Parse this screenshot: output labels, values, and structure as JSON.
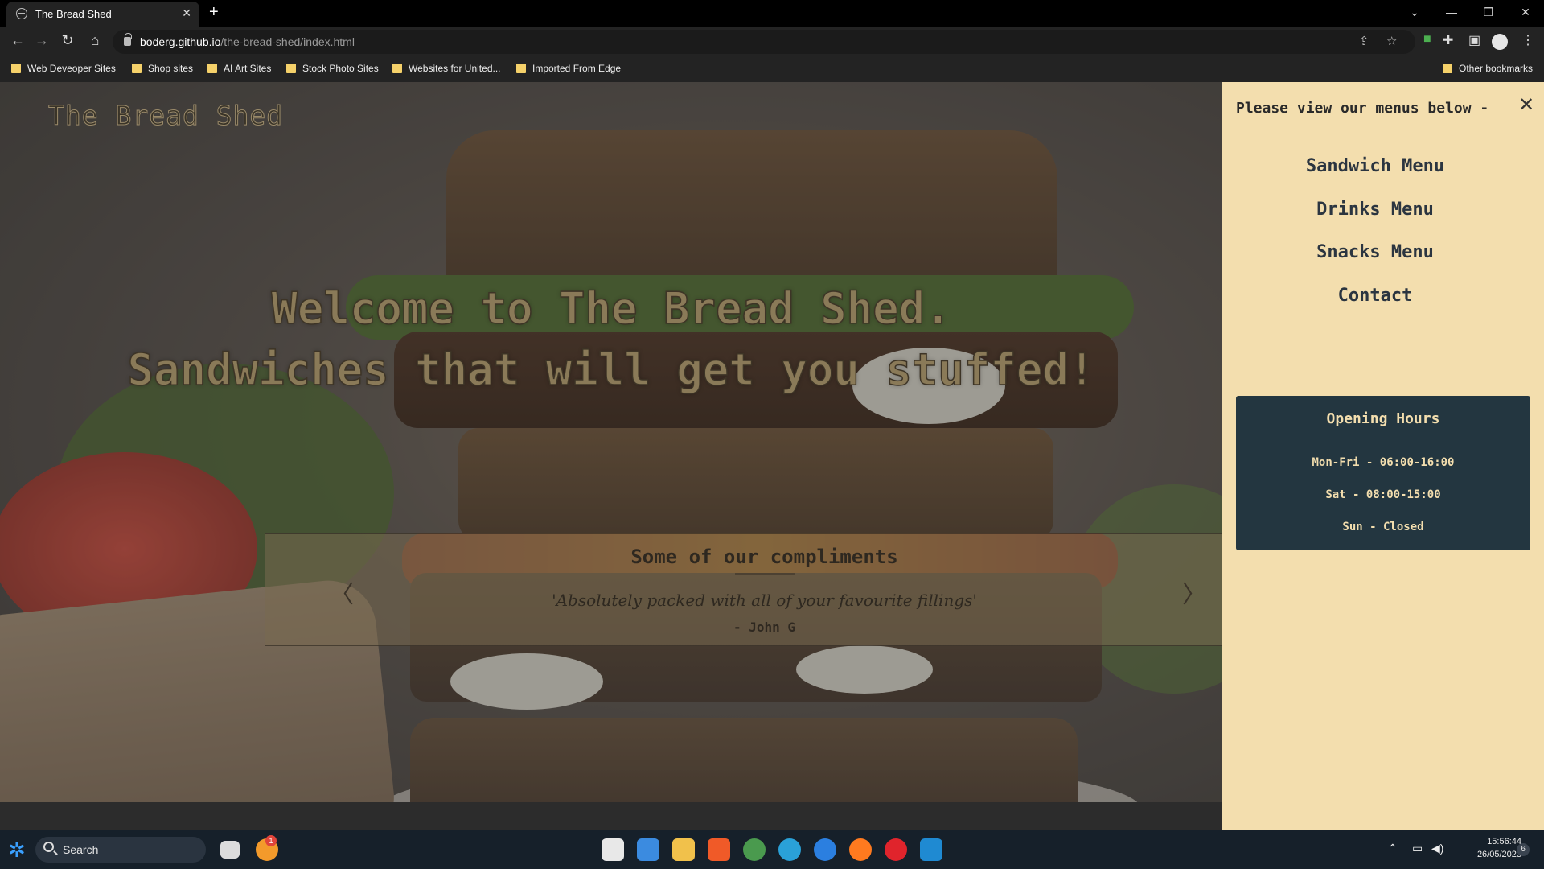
{
  "browser": {
    "tab_title": "The Bread Shed",
    "url_host": "boderg.github.io",
    "url_path": "/the-bread-shed/index.html",
    "bookmarks": [
      "Web Deveoper Sites",
      "Shop sites",
      "AI Art Sites",
      "Stock Photo Sites",
      "Websites for United...",
      "Imported From Edge"
    ],
    "other_bookmarks": "Other bookmarks"
  },
  "site": {
    "logo": "The Bread Shed",
    "headline_1": "Welcome to The Bread Shed.",
    "headline_2": "Sandwiches that will get you stuffed!",
    "carousel": {
      "title": "Some of our compliments",
      "quote": "'Absolutely packed with all of your favourite fillings'",
      "author": "- John G"
    }
  },
  "sidebar": {
    "heading": "Please view our menus below -",
    "links": [
      "Sandwich Menu",
      "Drinks Menu",
      "Snacks Menu",
      "Contact"
    ],
    "hours": {
      "title": "Opening Hours",
      "lines": [
        "Mon-Fri - 06:00-16:00",
        "Sat - 08:00-15:00",
        "Sun - Closed"
      ]
    }
  },
  "taskbar": {
    "search_label": "Search",
    "time": "15:56:44",
    "date": "26/05/2023",
    "notification_count": "1",
    "tray_badge": "6"
  },
  "colors": {
    "sidebar_bg": "#f3deae",
    "hours_bg": "#233640",
    "text_dark": "#2b3540"
  },
  "icons": [
    "globe-favicon-icon",
    "close-icon",
    "plus-icon",
    "back-icon",
    "forward-icon",
    "reload-icon",
    "home-icon",
    "lock-icon",
    "share-icon",
    "star-icon",
    "extensions-icon",
    "sidepanel-icon",
    "menu-dots-icon",
    "folder-icon",
    "chevron-left-icon",
    "chevron-right-icon",
    "start-icon",
    "search-icon"
  ]
}
